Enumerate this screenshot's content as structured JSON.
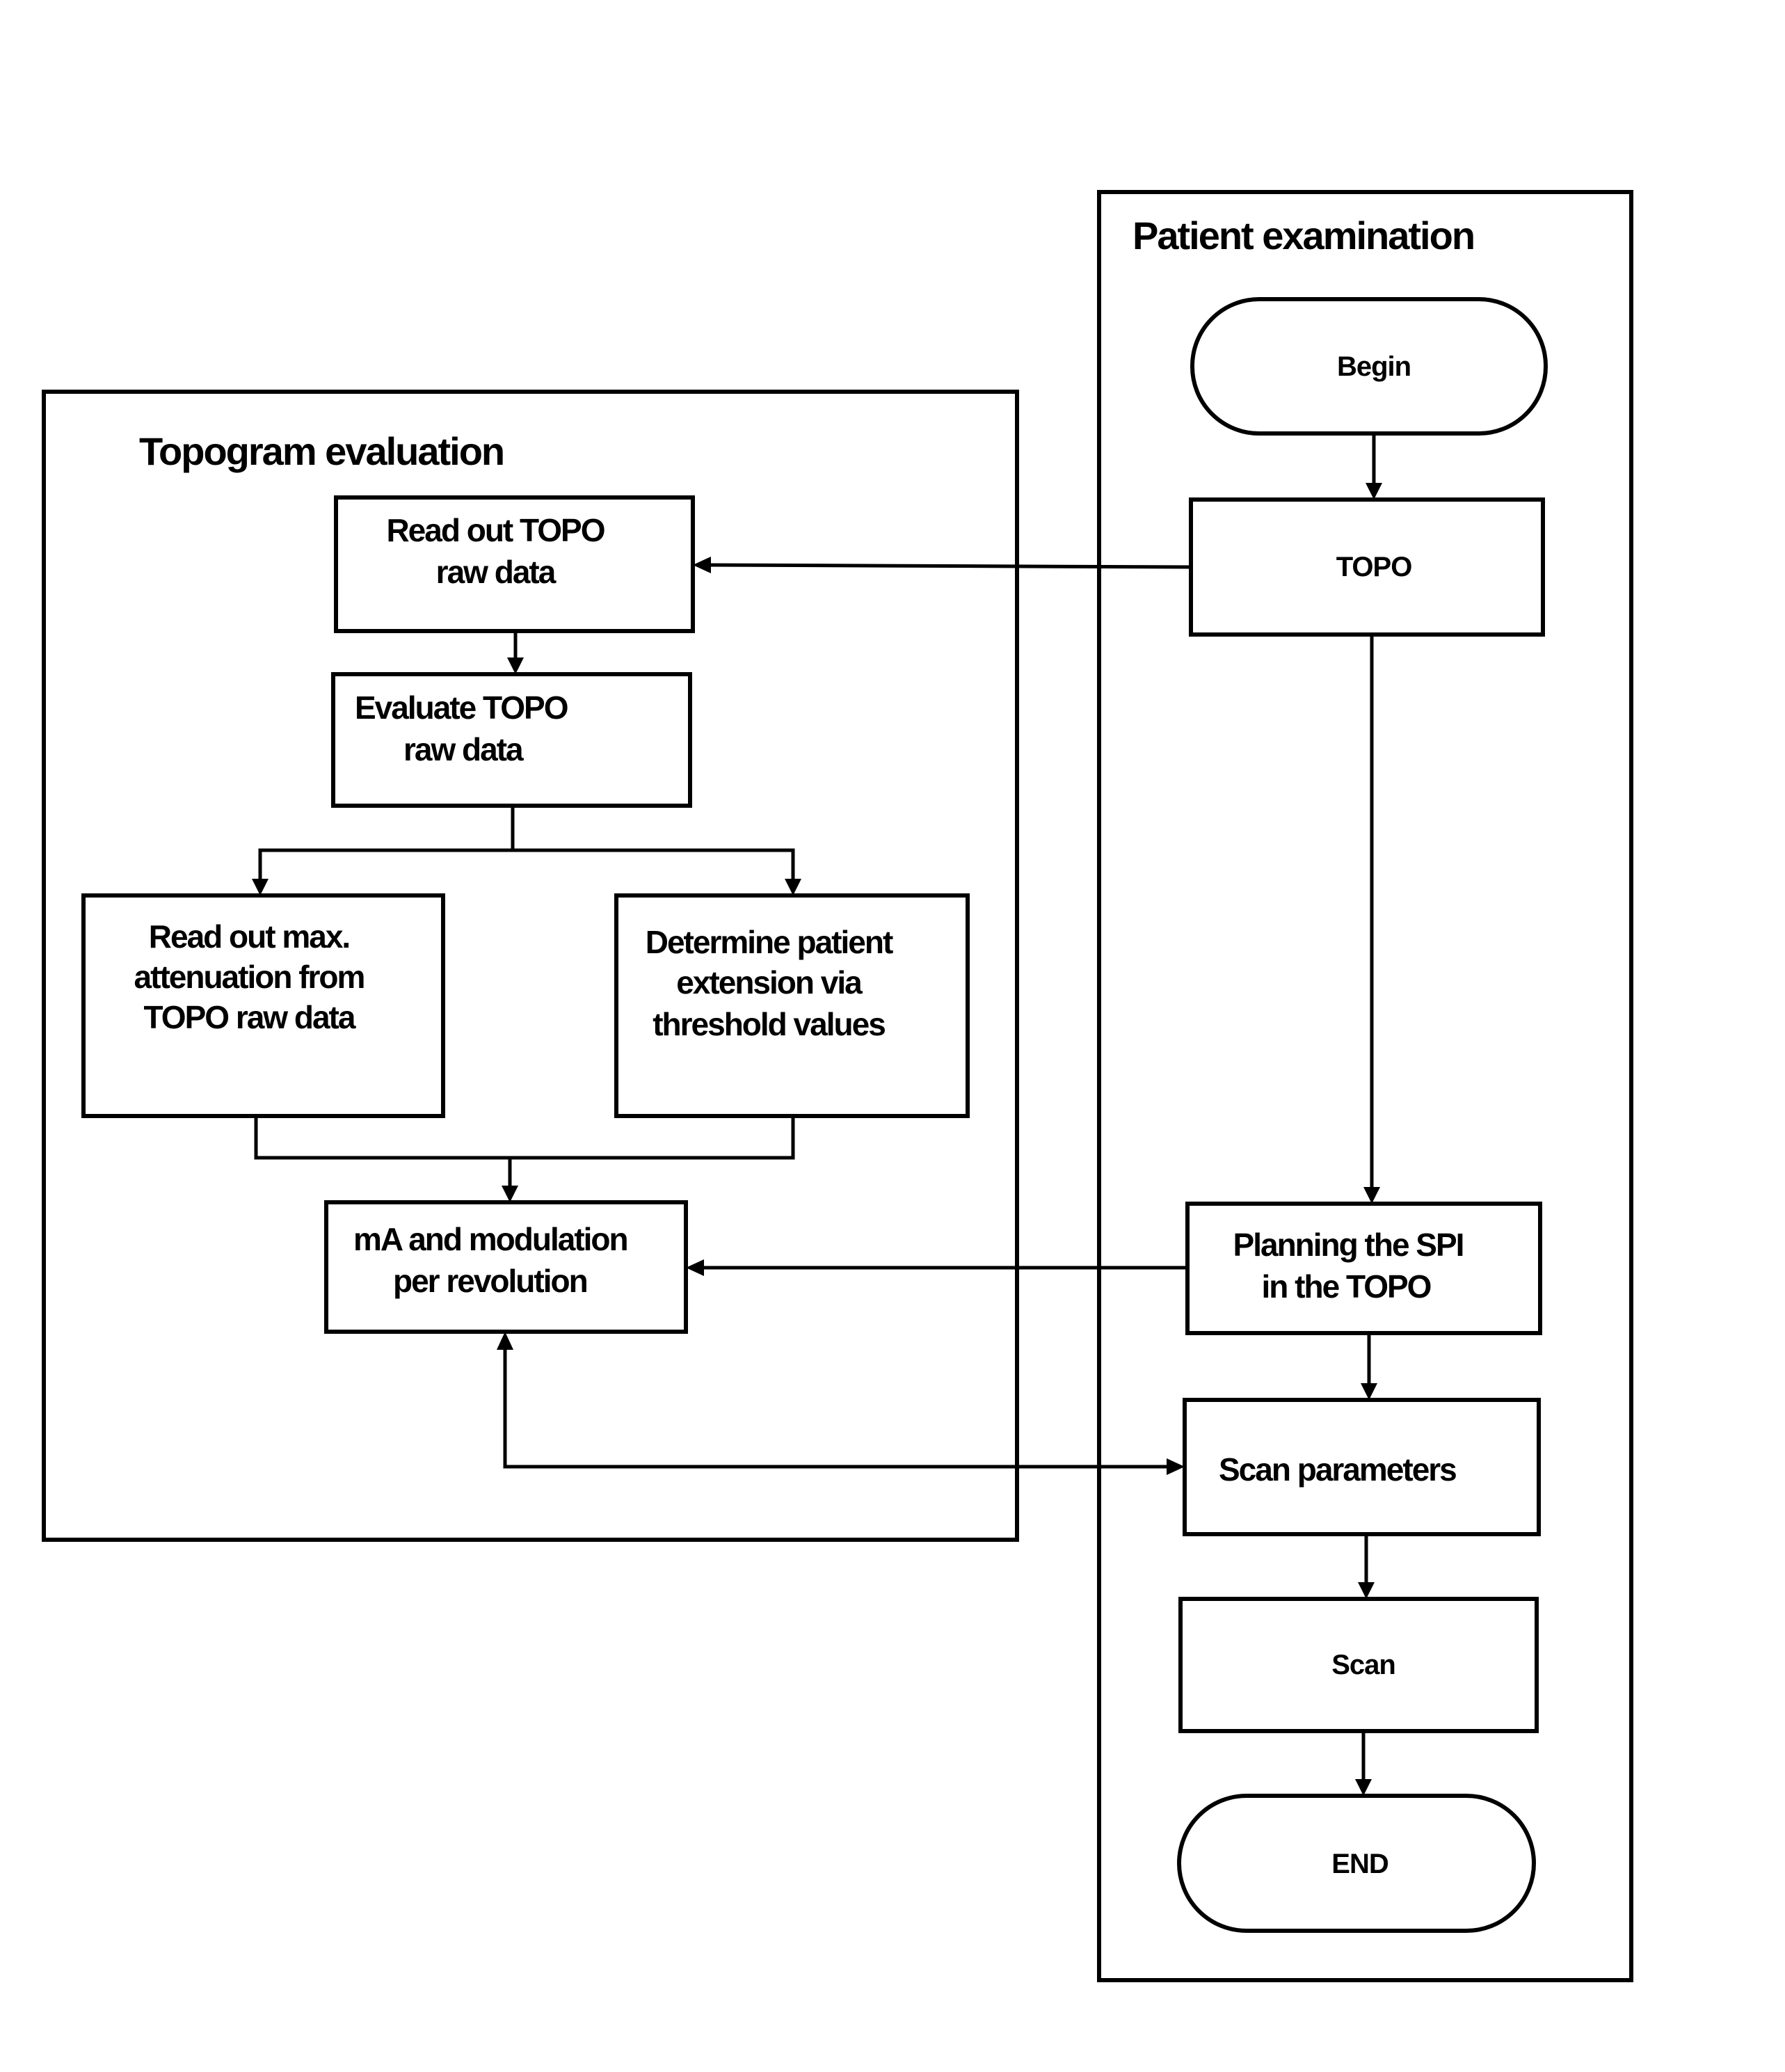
{
  "diagram": {
    "type": "flowchart",
    "lanes": {
      "topogram": {
        "title": "Topogram evaluation"
      },
      "patient": {
        "title": "Patient examination"
      }
    },
    "nodes": {
      "read_topo": {
        "lines": [
          "Read out TOPO",
          "raw data"
        ]
      },
      "evaluate_topo": {
        "lines": [
          "Evaluate TOPO",
          "raw data"
        ]
      },
      "read_max": {
        "lines": [
          "Read out max.",
          "attenuation from",
          "TOPO raw data"
        ]
      },
      "determine_ext": {
        "lines": [
          "Determine patient",
          "extension via",
          "threshold values"
        ]
      },
      "ma_modulation": {
        "lines": [
          "mA and modulation",
          "per revolution"
        ]
      },
      "begin": {
        "lines": [
          "Begin"
        ]
      },
      "topo": {
        "lines": [
          "TOPO"
        ]
      },
      "planning": {
        "lines": [
          "Planning the SPI",
          "in the TOPO"
        ]
      },
      "scan_params": {
        "lines": [
          "Scan parameters"
        ]
      },
      "scan": {
        "lines": [
          "Scan"
        ]
      },
      "end": {
        "lines": [
          "END"
        ]
      }
    },
    "edges": [
      {
        "from": "begin",
        "to": "topo"
      },
      {
        "from": "topo",
        "to": "read_topo"
      },
      {
        "from": "topo",
        "to": "planning"
      },
      {
        "from": "read_topo",
        "to": "evaluate_topo"
      },
      {
        "from": "evaluate_topo",
        "to": "read_max"
      },
      {
        "from": "evaluate_topo",
        "to": "determine_ext"
      },
      {
        "from": "read_max",
        "to": "ma_modulation"
      },
      {
        "from": "determine_ext",
        "to": "ma_modulation"
      },
      {
        "from": "planning",
        "to": "ma_modulation"
      },
      {
        "from": "planning",
        "to": "scan_params"
      },
      {
        "from": "ma_modulation",
        "to": "scan_params",
        "bidirectional": true
      },
      {
        "from": "scan_params",
        "to": "scan"
      },
      {
        "from": "scan",
        "to": "end"
      }
    ]
  }
}
